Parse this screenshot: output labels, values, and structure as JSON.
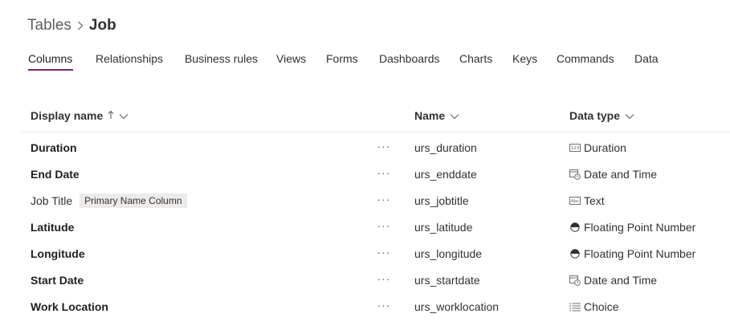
{
  "breadcrumb": {
    "root": "Tables",
    "current": "Job"
  },
  "tabs": [
    {
      "label": "Columns",
      "active": true
    },
    {
      "label": "Relationships"
    },
    {
      "label": "Business rules"
    },
    {
      "label": "Views"
    },
    {
      "label": "Forms"
    },
    {
      "label": "Dashboards"
    },
    {
      "label": "Charts"
    },
    {
      "label": "Keys"
    },
    {
      "label": "Commands"
    },
    {
      "label": "Data"
    }
  ],
  "grid": {
    "headers": {
      "display_name": "Display name",
      "name": "Name",
      "data_type": "Data type"
    },
    "sort": {
      "column": "display_name",
      "direction": "ascending"
    },
    "accent_color": "#742774",
    "rows": [
      {
        "display_name": "Duration",
        "bold": true,
        "name": "urs_duration",
        "data_type": "Duration",
        "icon": "duration-icon",
        "more": "···"
      },
      {
        "display_name": "End Date",
        "bold": true,
        "name": "urs_enddate",
        "data_type": "Date and Time",
        "icon": "calendar-clock-icon",
        "more": "···"
      },
      {
        "display_name": "Job Title",
        "bold": false,
        "badge": "Primary Name Column",
        "name": "urs_jobtitle",
        "data_type": "Text",
        "icon": "text-icon",
        "more": "···"
      },
      {
        "display_name": "Latitude",
        "bold": true,
        "name": "urs_latitude",
        "data_type": "Floating Point Number",
        "icon": "half-circle-icon",
        "more": "···"
      },
      {
        "display_name": "Longitude",
        "bold": true,
        "name": "urs_longitude",
        "data_type": "Floating Point Number",
        "icon": "half-circle-icon",
        "more": "···"
      },
      {
        "display_name": "Start Date",
        "bold": true,
        "name": "urs_startdate",
        "data_type": "Date and Time",
        "icon": "calendar-clock-icon",
        "more": "···"
      },
      {
        "display_name": "Work Location",
        "bold": true,
        "name": "urs_worklocation",
        "data_type": "Choice",
        "icon": "choice-list-icon",
        "more": "···"
      }
    ]
  }
}
